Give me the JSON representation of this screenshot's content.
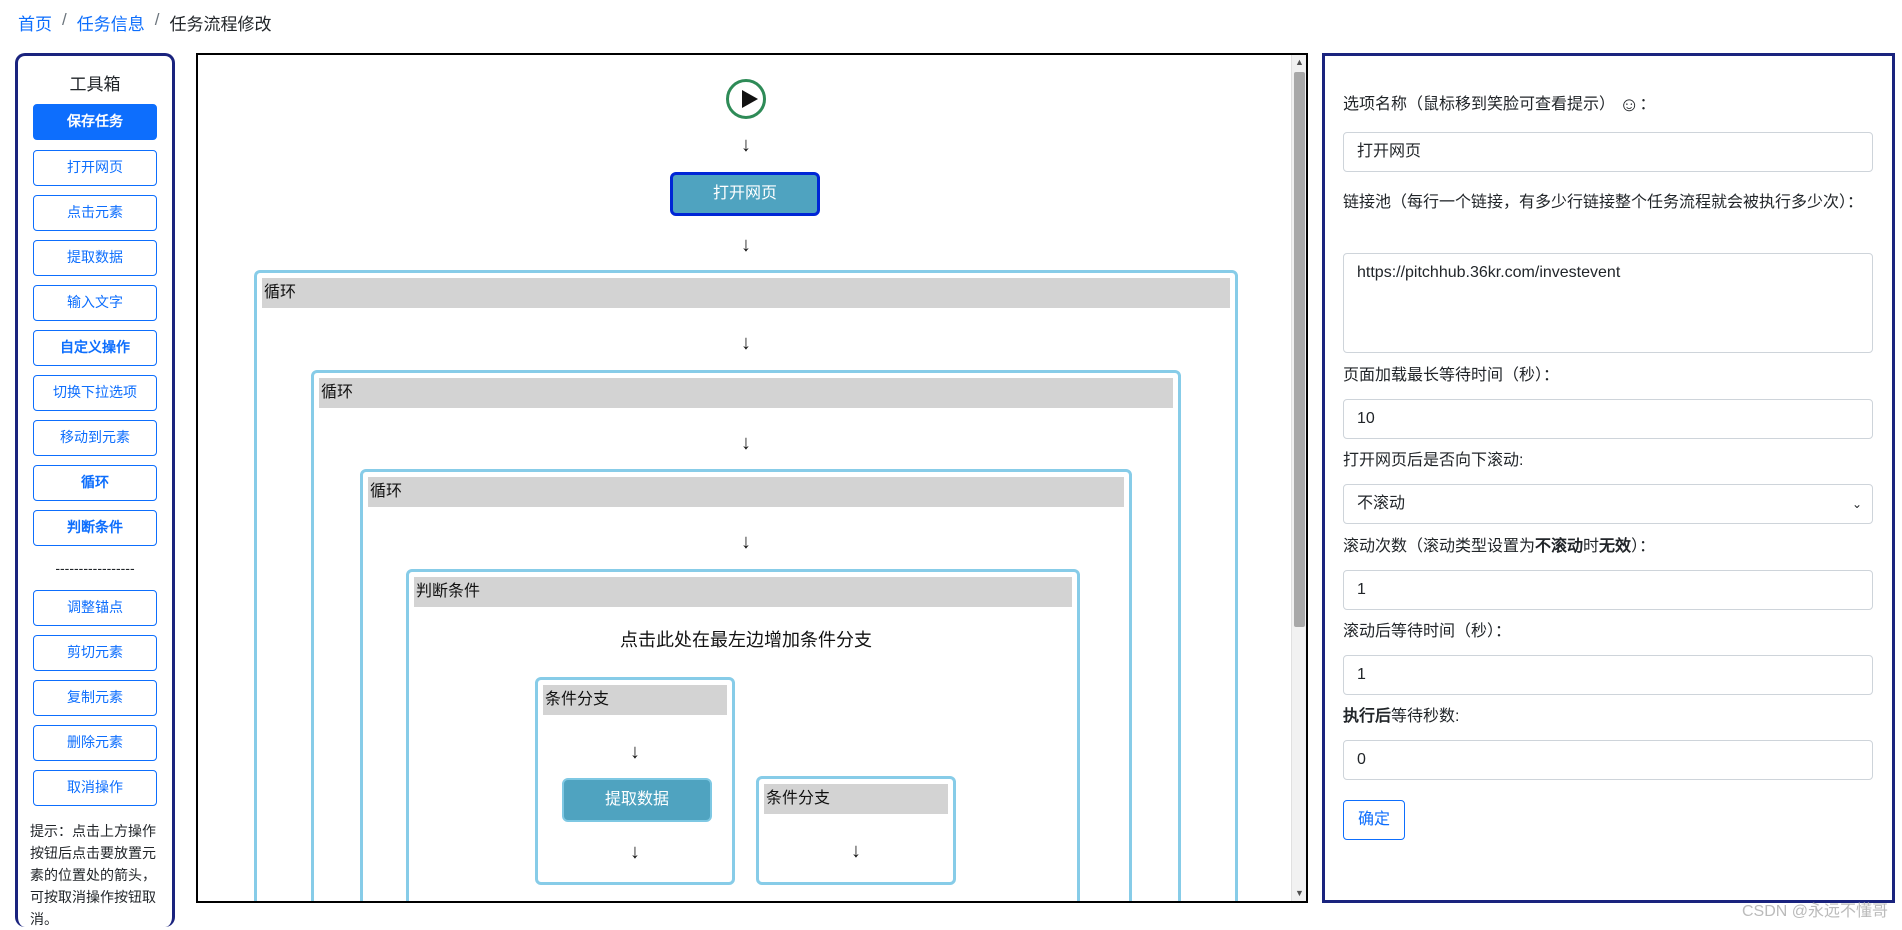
{
  "breadcrumb": {
    "home": "首页",
    "task_info": "任务信息",
    "current": "任务流程修改",
    "separator": "/"
  },
  "toolbox": {
    "title": "工具箱",
    "save": "保存任务",
    "buttons_top": [
      "打开网页",
      "点击元素",
      "提取数据",
      "输入文字",
      "自定义操作",
      "切换下拉选项",
      "移动到元素",
      "循环",
      "判断条件"
    ],
    "divider": "-----------------",
    "buttons_bottom": [
      "调整锚点",
      "剪切元素",
      "复制元素",
      "删除元素",
      "取消操作"
    ],
    "hint": "提示：点击上方操作按钮后点击要放置元素的位置处的箭头，可按取消操作按钮取消。"
  },
  "canvas": {
    "arrow": "↓",
    "open_page_node": "打开网页",
    "loop_label": "循环",
    "condition_label": "判断条件",
    "add_branch": "点击此处在最左边增加条件分支",
    "branch_label": "条件分支",
    "extract_node": "提取数据"
  },
  "panel": {
    "option_name_label": "选项名称（鼠标移到笑脸可查看提示）",
    "option_name_suffix": "：",
    "smile_icon": "☺",
    "option_name_value": "打开网页",
    "link_pool_label": "链接池（每行一个链接，有多少行链接整个任务流程就会被执行多少次）：",
    "link_pool_value": "https://pitchhub.36kr.com/investevent",
    "max_wait_label": "页面加载最长等待时间（秒）：",
    "max_wait_value": "10",
    "scroll_label": "打开网页后是否向下滚动:",
    "scroll_value": "不滚动",
    "scroll_count_label_a": "滚动次数（滚动类型设置为",
    "scroll_count_label_b": "不滚动",
    "scroll_count_label_c": "时",
    "scroll_count_label_d": "无效",
    "scroll_count_label_e": "）：",
    "scroll_count_value": "1",
    "scroll_wait_label": "滚动后等待时间（秒）：",
    "scroll_wait_value": "1",
    "after_wait_label_a": "执行后",
    "after_wait_label_b": "等待秒数:",
    "after_wait_value": "0",
    "confirm": "确定"
  },
  "watermark": "CSDN @永远不懂哥"
}
